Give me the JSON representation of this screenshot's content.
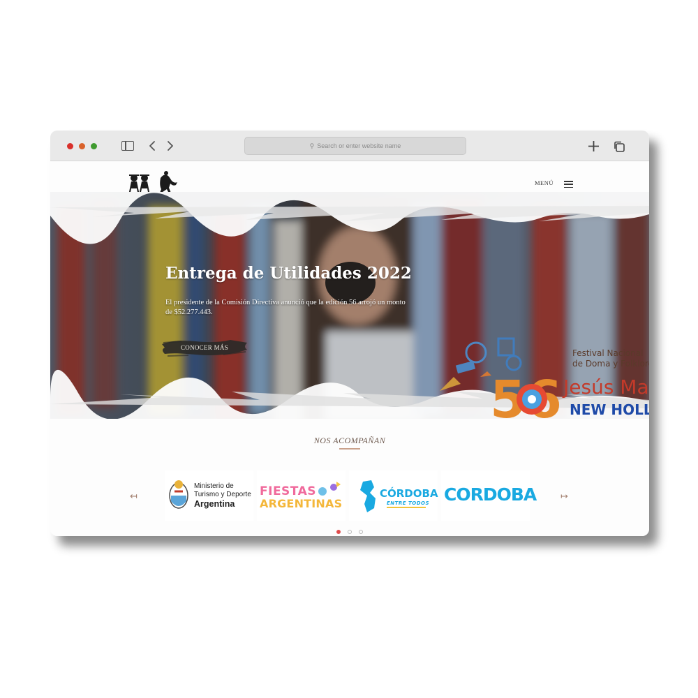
{
  "browser": {
    "address_placeholder": "Search or enter website name"
  },
  "header": {
    "menu_label": "MENÚ"
  },
  "hero": {
    "title": "Entrega de Utilidades 2022",
    "subtitle": "El presidente de la Comisión Directiva anunció que la edición 56 arrojó un monto de $52.277.443.",
    "cta_label": "CONOCER MÁS",
    "festival_badge": {
      "number": "56",
      "line1": "Festival Nacional",
      "line2": "de Doma y Folklore",
      "place": "Jesús María",
      "sponsor": "NEW HOLLAND"
    }
  },
  "sponsors": {
    "title": "NOS ACOMPAÑAN",
    "prev_icon": "arrow-left-icon",
    "next_icon": "arrow-right-icon",
    "logos": [
      {
        "line1": "Ministerio de",
        "line2": "Turismo y Deporte",
        "line3": "Argentina"
      },
      {
        "line1": "FIESTAS",
        "line2": "ARGENTINAS"
      },
      {
        "line1": "CÓRDOBA",
        "line2": "ENTRE TODOS"
      },
      {
        "line1": "CORDOBA"
      }
    ],
    "pagination": {
      "pages": 3,
      "active": 1
    }
  },
  "colors": {
    "accent": "#c9a08a",
    "title_brown": "#6e5a4f",
    "cordoba_blue": "#19a9e1",
    "active_dot": "#e04b4b"
  }
}
